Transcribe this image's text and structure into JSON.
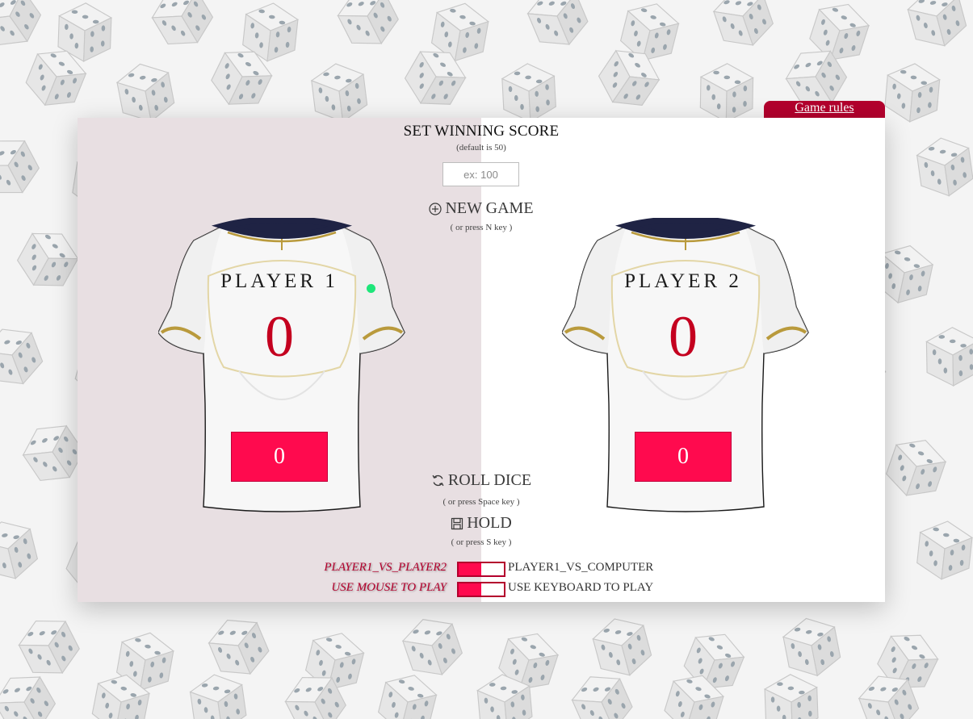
{
  "rules_link": {
    "label": "Game rules"
  },
  "winning_score": {
    "title": "SET WINNING SCORE",
    "default_note": "(default is 50)",
    "placeholder": "ex: 100",
    "value": ""
  },
  "controls": {
    "new_game": {
      "label": "NEW GAME",
      "hint": "( or press N key )",
      "icon": "plus-circle-icon"
    },
    "roll_dice": {
      "label": "ROLL DICE",
      "hint": "( or press Space key )",
      "icon": "refresh-icon"
    },
    "hold": {
      "label": "HOLD",
      "hint": "( or press S key )",
      "icon": "save-icon"
    }
  },
  "players": [
    {
      "name": "PLAYER 1",
      "score": "0",
      "current": "0",
      "active": true
    },
    {
      "name": "PLAYER 2",
      "score": "0",
      "current": "0",
      "active": false
    }
  ],
  "modes": {
    "opponent": {
      "left_label": "PLAYER1_VS_PLAYER2",
      "right_label": "PLAYER1_VS_COMPUTER",
      "selected": "left"
    },
    "input": {
      "left_label": "USE MOUSE TO PLAY",
      "right_label": "USE KEYBOARD TO PLAY",
      "selected": "left"
    }
  },
  "colors": {
    "accent": "#b3002d",
    "current_box": "#ff0a4e",
    "score": "#c4001f",
    "turn_indicator": "#1ee67a",
    "active_background": "#e8dfe2"
  }
}
